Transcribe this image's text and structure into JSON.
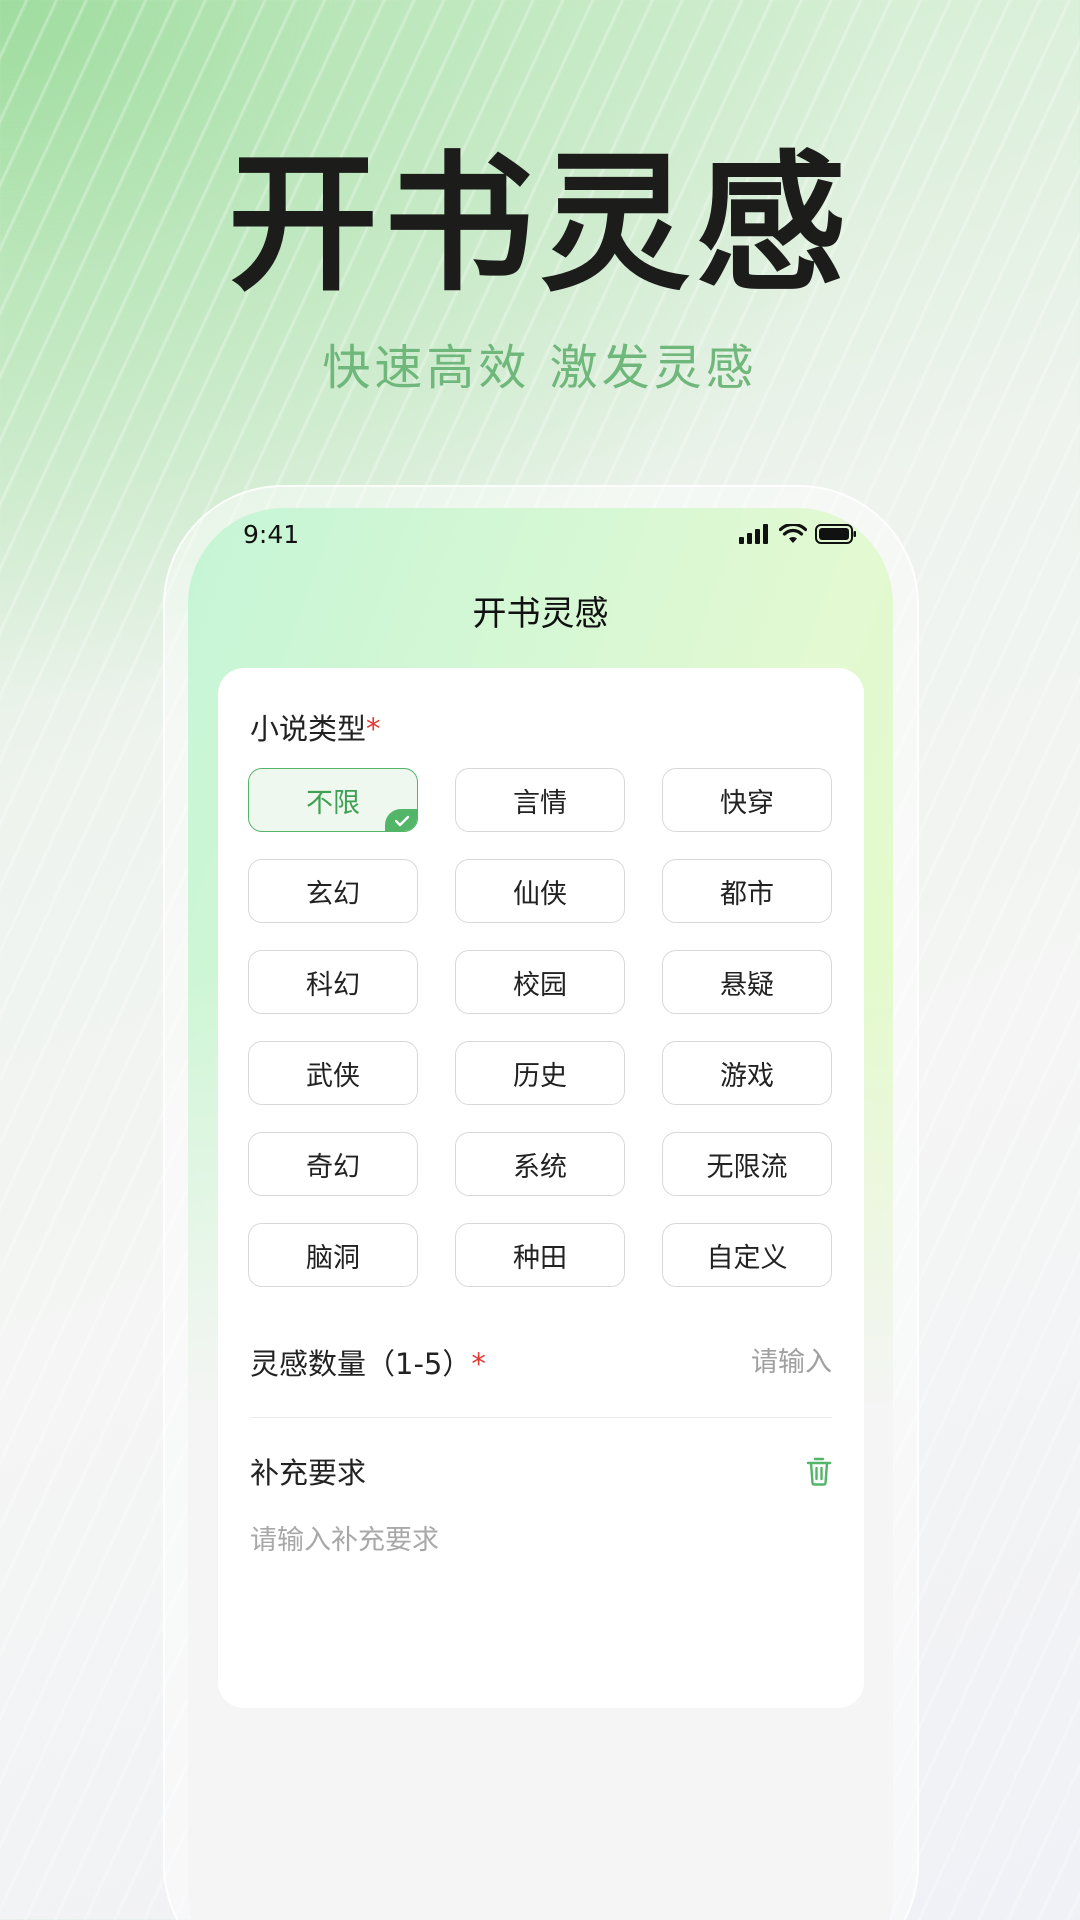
{
  "hero": {
    "title": "开书灵感",
    "subtitle": "快速高效  激发灵感"
  },
  "status_bar": {
    "time": "9:41",
    "icons": [
      "signal-icon",
      "wifi-icon",
      "battery-icon"
    ]
  },
  "nav": {
    "title": "开书灵感"
  },
  "form": {
    "genre_label": "小说类型",
    "required_mark": "*",
    "genres": [
      {
        "label": "不限",
        "selected": true
      },
      {
        "label": "言情",
        "selected": false
      },
      {
        "label": "快穿",
        "selected": false
      },
      {
        "label": "玄幻",
        "selected": false
      },
      {
        "label": "仙侠",
        "selected": false
      },
      {
        "label": "都市",
        "selected": false
      },
      {
        "label": "科幻",
        "selected": false
      },
      {
        "label": "校园",
        "selected": false
      },
      {
        "label": "悬疑",
        "selected": false
      },
      {
        "label": "武侠",
        "selected": false
      },
      {
        "label": "历史",
        "selected": false
      },
      {
        "label": "游戏",
        "selected": false
      },
      {
        "label": "奇幻",
        "selected": false
      },
      {
        "label": "系统",
        "selected": false
      },
      {
        "label": "无限流",
        "selected": false
      },
      {
        "label": "脑洞",
        "selected": false
      },
      {
        "label": "种田",
        "selected": false
      },
      {
        "label": "自定义",
        "selected": false
      }
    ],
    "count_label": "灵感数量（1-5）",
    "count_value": "",
    "count_placeholder": "请输入",
    "supplement_label": "补充要求",
    "supplement_value": "",
    "supplement_placeholder": "请输入补充要求"
  },
  "colors": {
    "accent": "#52b567",
    "required": "#e53935",
    "subtitle": "#6fb77a"
  }
}
